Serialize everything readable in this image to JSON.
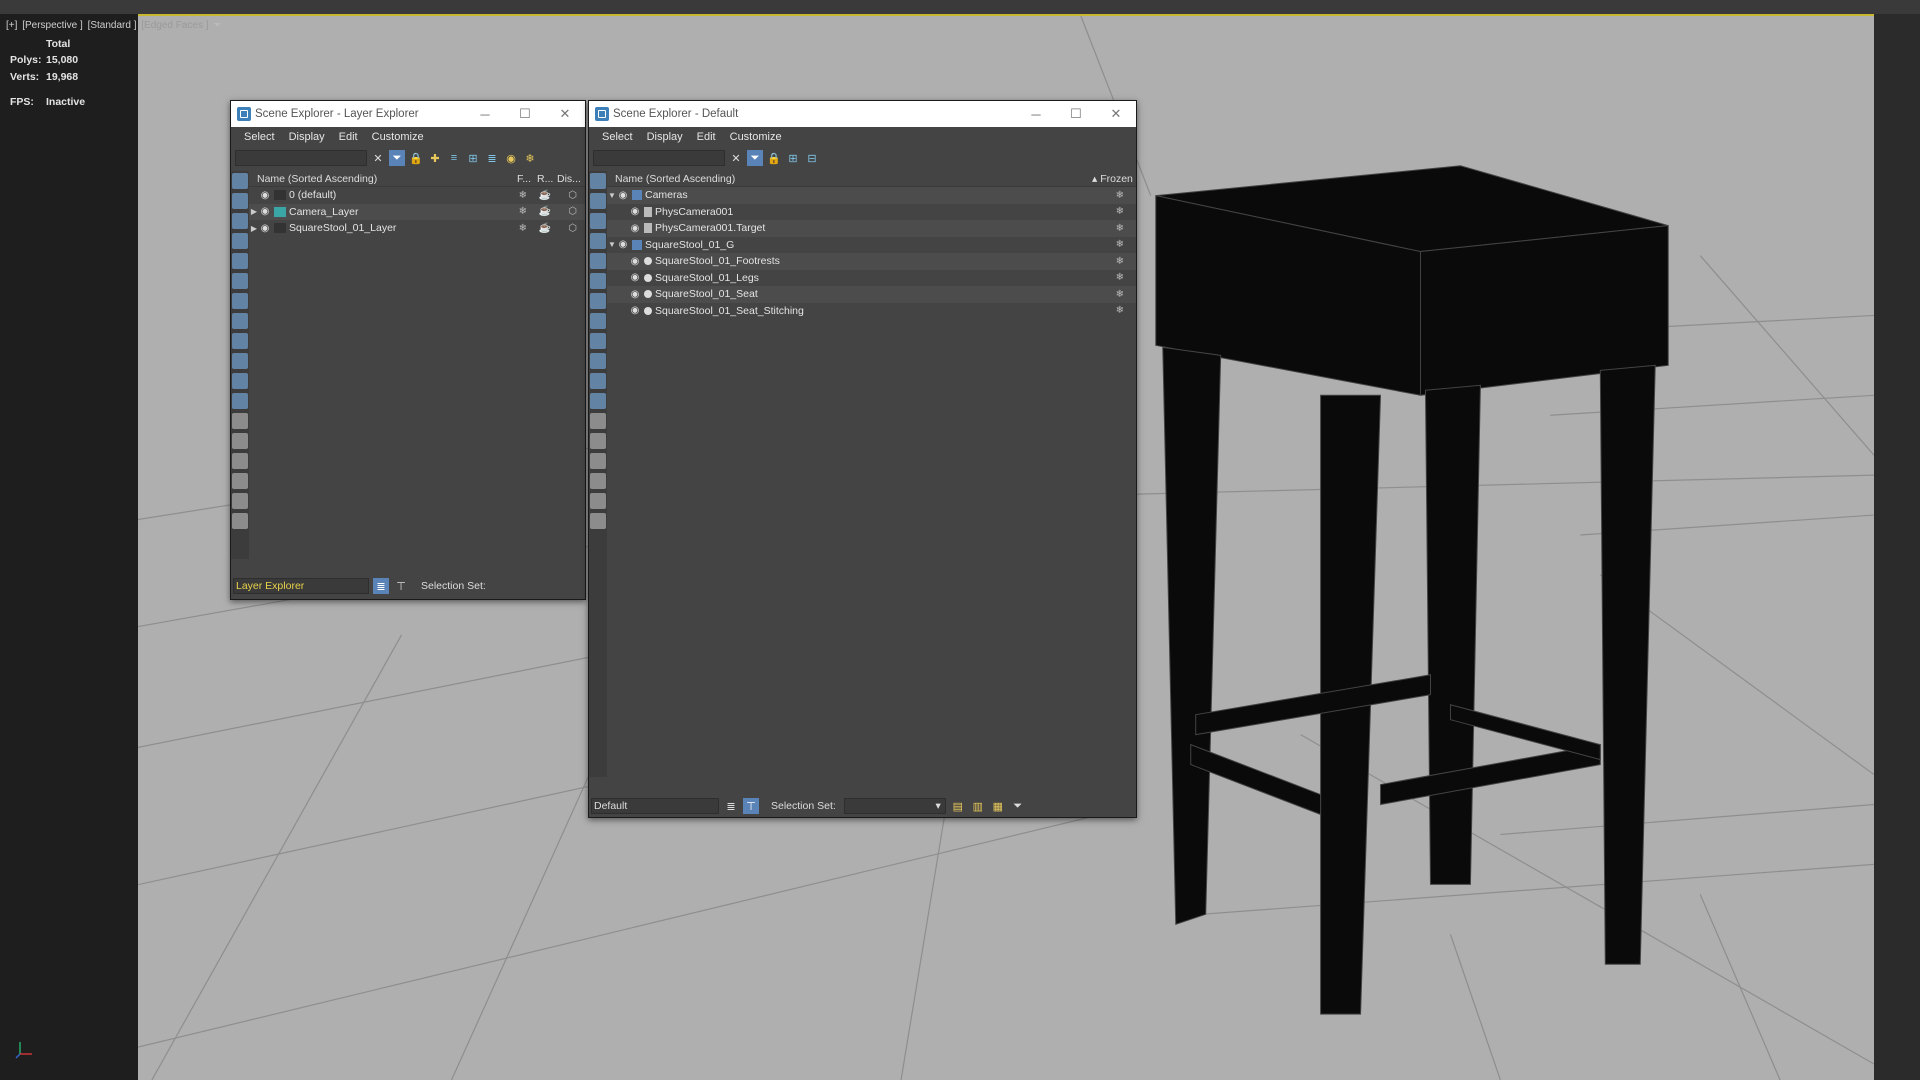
{
  "viewport": {
    "labels": [
      "[+]",
      "[Perspective ]",
      "[Standard ]",
      "[Edged Faces ]"
    ],
    "stats": {
      "total_label": "Total",
      "polys_label": "Polys:",
      "polys": "15,080",
      "verts_label": "Verts:",
      "verts": "19,968",
      "fps_label": "FPS:",
      "fps": "Inactive"
    }
  },
  "layer_explorer": {
    "title": "Scene Explorer - Layer Explorer",
    "menu": [
      "Select",
      "Display",
      "Edit",
      "Customize"
    ],
    "header": {
      "name": "Name (Sorted Ascending)",
      "col1": "F...",
      "col2": "R...",
      "col3": "Dis..."
    },
    "rows": [
      {
        "label": "0 (default)"
      },
      {
        "label": "Camera_Layer"
      },
      {
        "label": "SquareStool_01_Layer"
      }
    ],
    "bottom": {
      "mode": "Layer Explorer",
      "selection_set_label": "Selection Set:"
    }
  },
  "default_explorer": {
    "title": "Scene Explorer - Default",
    "menu": [
      "Select",
      "Display",
      "Edit",
      "Customize"
    ],
    "header": {
      "name": "Name (Sorted Ascending)",
      "frozen": "Frozen"
    },
    "rows": [
      {
        "label": "Cameras"
      },
      {
        "label": "PhysCamera001"
      },
      {
        "label": "PhysCamera001.Target"
      },
      {
        "label": "SquareStool_01_G"
      },
      {
        "label": "SquareStool_01_Footrests"
      },
      {
        "label": "SquareStool_01_Legs"
      },
      {
        "label": "SquareStool_01_Seat"
      },
      {
        "label": "SquareStool_01_Seat_Stitching"
      }
    ],
    "bottom": {
      "mode": "Default",
      "selection_set_label": "Selection Set:"
    }
  },
  "colors": {
    "viewport_border": "#c8b830",
    "active_tool": "#5a84b8",
    "layer_mode_text": "#e8d24a"
  }
}
